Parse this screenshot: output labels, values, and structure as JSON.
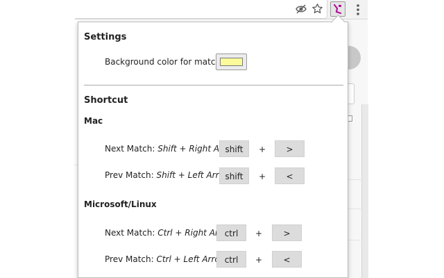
{
  "colors": {
    "match_background": "#fbfb9c",
    "key_background": "#dcdcdc",
    "extension_icon_accent": "#b0149a"
  },
  "toolbar": {
    "icons": [
      "eye-icon",
      "star-icon",
      "extension-icon",
      "menu-icon"
    ]
  },
  "settings": {
    "title": "Settings",
    "background_color_label": "Background color for matches"
  },
  "shortcut": {
    "title": "Shortcut",
    "mac": {
      "heading": "Mac",
      "next": {
        "prefix": "Next Match: ",
        "combo": "Shift + Right Arrow",
        "modifier_key": "shift",
        "plus": "+",
        "key": ">"
      },
      "prev": {
        "prefix": "Prev Match: ",
        "combo": "Shift + Left Arrow",
        "modifier_key": "shift",
        "plus": "+",
        "key": "<"
      }
    },
    "linux": {
      "heading": "Microsoft/Linux",
      "next": {
        "prefix": "Next Match: ",
        "combo": "Ctrl + Right Arrow",
        "modifier_key": "ctrl",
        "plus": "+",
        "key": ">"
      },
      "prev": {
        "prefix": "Prev Match: ",
        "combo": "Ctrl + Left Arrow",
        "modifier_key": "ctrl",
        "plus": "+",
        "key": "<"
      }
    }
  }
}
